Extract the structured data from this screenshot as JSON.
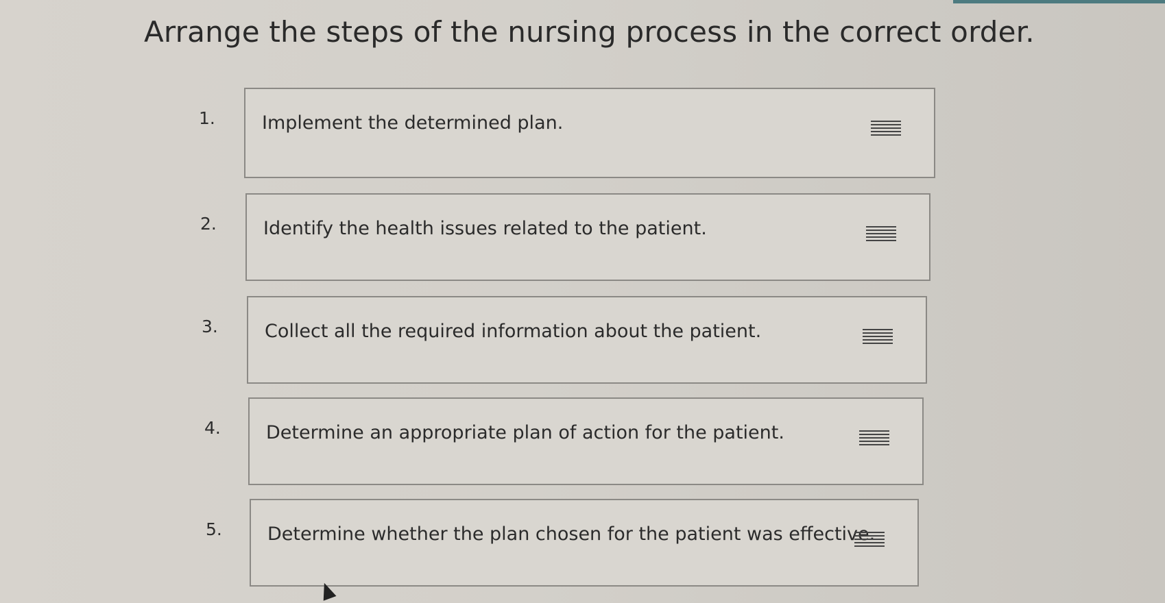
{
  "title": "Arrange the steps of the nursing process in the correct order.",
  "steps": [
    {
      "number": "1.",
      "text": "Implement the determined plan.",
      "handle_icon": "drag-handle-icon"
    },
    {
      "number": "2.",
      "text": "Identify the health issues related to the patient.",
      "handle_icon": "drag-handle-icon"
    },
    {
      "number": "3.",
      "text": "Collect all the required information about the patient.",
      "handle_icon": "drag-handle-icon"
    },
    {
      "number": "4.",
      "text": "Determine an appropriate plan of action for the patient.",
      "handle_icon": "drag-handle-icon"
    },
    {
      "number": "5.",
      "text": "Determine whether the plan chosen for the patient was effective.",
      "handle_icon": "drag-handle-icon"
    }
  ],
  "colors": {
    "background": "#d4d0ca",
    "box_border": "#8b8985",
    "text": "#2b2b2b",
    "accent_strip": "#4d7b80"
  }
}
